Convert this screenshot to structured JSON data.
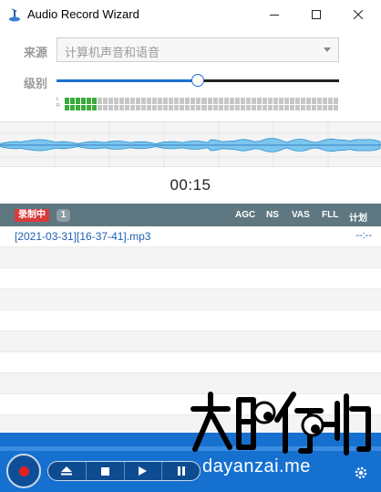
{
  "window": {
    "title": "Audio Record Wizard"
  },
  "source": {
    "label": "来源",
    "selected": "计算机声音和语音"
  },
  "level": {
    "label": "级别",
    "value_fraction": 0.5
  },
  "vu_meter": {
    "channels": [
      "L",
      "R"
    ],
    "lit_segments": 6,
    "total_segments": 50
  },
  "timer": "00:15",
  "list_header": {
    "recording_badge": "录制中",
    "count": "1",
    "columns": [
      "AGC",
      "NS",
      "VAS",
      "FLL",
      "计划"
    ]
  },
  "recordings": [
    {
      "name": "[2021-03-31][16-37-41].mp3",
      "duration": "--:--"
    }
  ],
  "watermark": {
    "domain": "dayanzai.me"
  },
  "colors": {
    "accent": "#1e6fd0",
    "header_bar": "#5e7780",
    "bottom_bar": "#1670d0",
    "record_red": "#e81e1e",
    "meter_green": "#3cab3c"
  }
}
